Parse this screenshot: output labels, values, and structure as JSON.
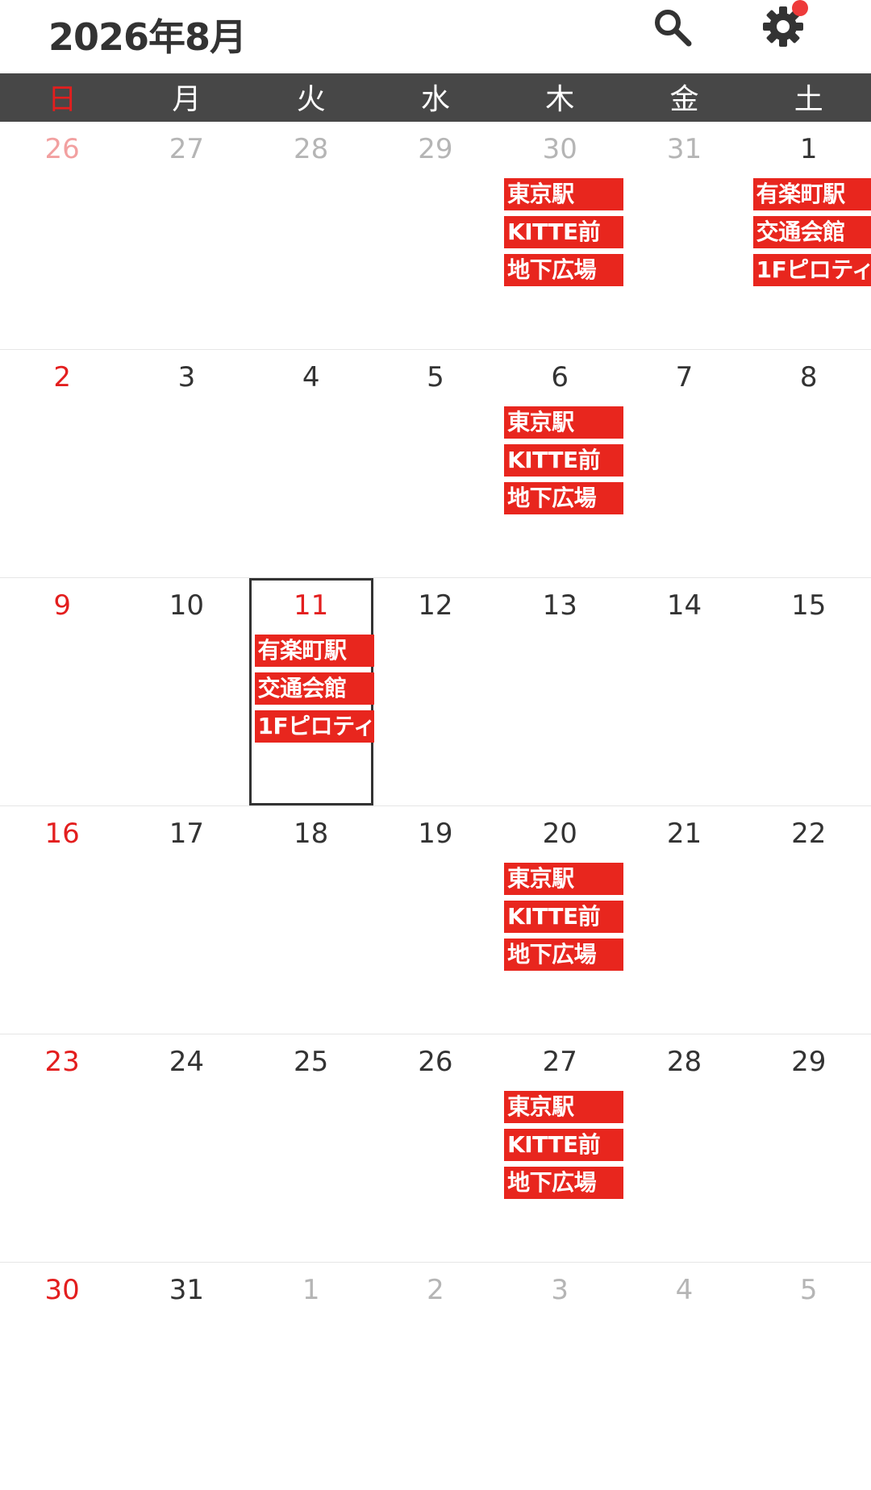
{
  "header": {
    "title": "2026年8月",
    "search_icon": "search-icon",
    "settings_icon": "gear-icon",
    "notification_dot_color": "#ee3b3b"
  },
  "colors": {
    "weekday_bar": "#474747",
    "sunday_red": "#e31e1e",
    "sunday_faded": "#f2a0a0",
    "weekday_text": "#333333",
    "faded_text": "#b5b5b5",
    "event_bg": "#e8261e"
  },
  "weekdays": [
    "日",
    "月",
    "火",
    "水",
    "木",
    "金",
    "土"
  ],
  "weeks": [
    {
      "days": [
        {
          "num": "26",
          "faded": true
        },
        {
          "num": "27",
          "faded": true
        },
        {
          "num": "28",
          "faded": true
        },
        {
          "num": "29",
          "faded": true
        },
        {
          "num": "30",
          "faded": true,
          "events": [
            "東京駅",
            "KITTE前",
            "地下広場"
          ]
        },
        {
          "num": "31",
          "faded": true
        },
        {
          "num": "1",
          "events": [
            "有楽町駅",
            "交通会館",
            "1Fピロティ"
          ]
        }
      ]
    },
    {
      "days": [
        {
          "num": "2"
        },
        {
          "num": "3"
        },
        {
          "num": "4"
        },
        {
          "num": "5"
        },
        {
          "num": "6",
          "events": [
            "東京駅",
            "KITTE前",
            "地下広場"
          ]
        },
        {
          "num": "7"
        },
        {
          "num": "8"
        }
      ]
    },
    {
      "days": [
        {
          "num": "9"
        },
        {
          "num": "10"
        },
        {
          "num": "11",
          "today": true,
          "events": [
            "有楽町駅",
            "交通会館",
            "1Fピロティ"
          ]
        },
        {
          "num": "12"
        },
        {
          "num": "13"
        },
        {
          "num": "14"
        },
        {
          "num": "15"
        }
      ]
    },
    {
      "days": [
        {
          "num": "16"
        },
        {
          "num": "17"
        },
        {
          "num": "18"
        },
        {
          "num": "19"
        },
        {
          "num": "20",
          "events": [
            "東京駅",
            "KITTE前",
            "地下広場"
          ]
        },
        {
          "num": "21"
        },
        {
          "num": "22"
        }
      ]
    },
    {
      "days": [
        {
          "num": "23"
        },
        {
          "num": "24"
        },
        {
          "num": "25"
        },
        {
          "num": "26"
        },
        {
          "num": "27",
          "events": [
            "東京駅",
            "KITTE前",
            "地下広場"
          ]
        },
        {
          "num": "28"
        },
        {
          "num": "29"
        }
      ]
    },
    {
      "days": [
        {
          "num": "30"
        },
        {
          "num": "31"
        },
        {
          "num": "1",
          "faded": true
        },
        {
          "num": "2",
          "faded": true
        },
        {
          "num": "3",
          "faded": true
        },
        {
          "num": "4",
          "faded": true
        },
        {
          "num": "5",
          "faded": true
        }
      ]
    }
  ]
}
